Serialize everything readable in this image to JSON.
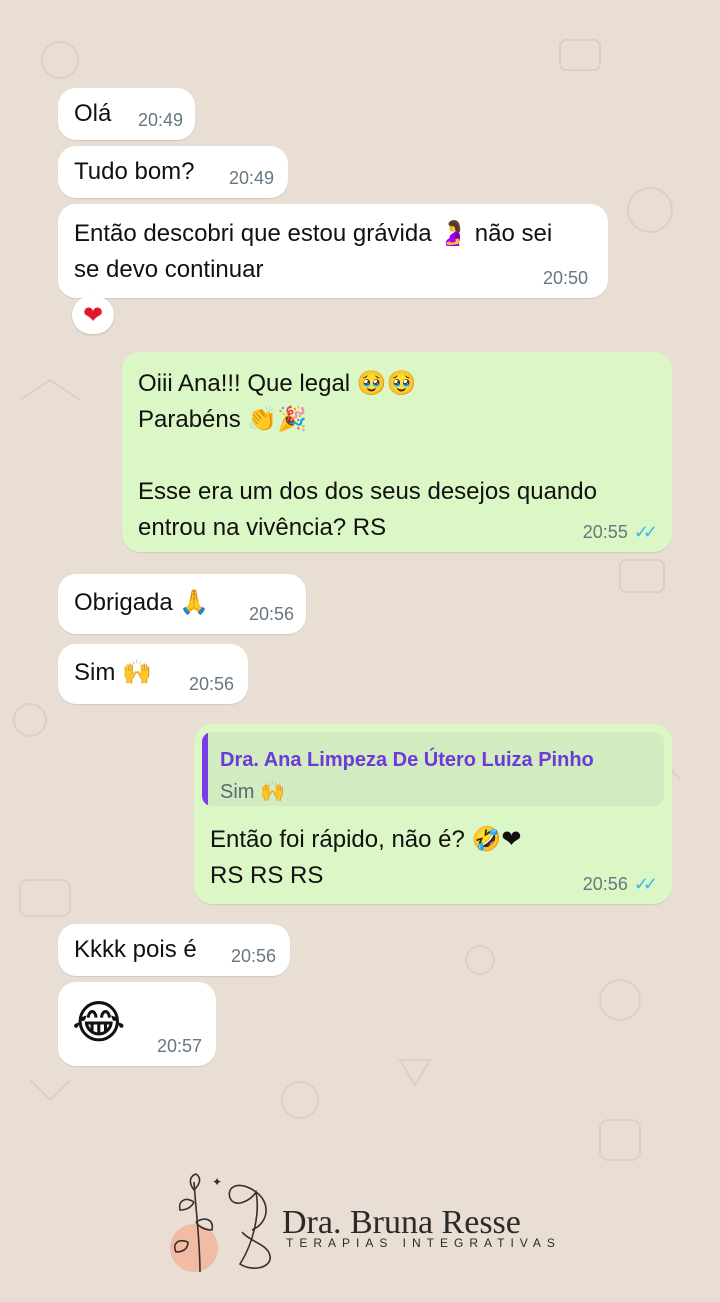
{
  "messages": {
    "m1": {
      "text": "Olá",
      "time": "20:49"
    },
    "m2": {
      "text": "Tudo bom?",
      "time": "20:49"
    },
    "m3": {
      "text": "Então descobri que estou grávida 🤰 não sei\nse devo continuar",
      "time": "20:50",
      "reaction": "❤"
    },
    "m4": {
      "text": "Oiii Ana!!! Que legal 🥹🥹\nParabéns 👏🎉\n\nEsse era um dos dos seus desejos quando\nentrou na vivência? RS",
      "time": "20:55",
      "ticks": "✓✓"
    },
    "m5": {
      "text": "Obrigada 🙏",
      "time": "20:56"
    },
    "m6": {
      "text": "Sim 🙌",
      "time": "20:56"
    },
    "m7": {
      "quote_name": "Dra. Ana Limpeza De Útero Luiza Pinho",
      "quote_text": "Sim 🙌",
      "text": "Então foi rápido, não é? 🤣❤\nRS RS RS",
      "time": "20:56",
      "ticks": "✓✓"
    },
    "m8": {
      "text": "Kkkk pois é",
      "time": "20:56"
    },
    "m9": {
      "text": "😂",
      "time": "20:57"
    }
  },
  "brand": {
    "name": "Dra. Bruna Resse",
    "subtitle": "TERAPIAS INTEGRATIVAS"
  },
  "colors": {
    "incoming": "#ffffff",
    "outgoing": "#dbf7c6",
    "background": "#e8ded4",
    "read_ticks": "#34b7f1",
    "quote_accent": "#7a3ce6"
  }
}
